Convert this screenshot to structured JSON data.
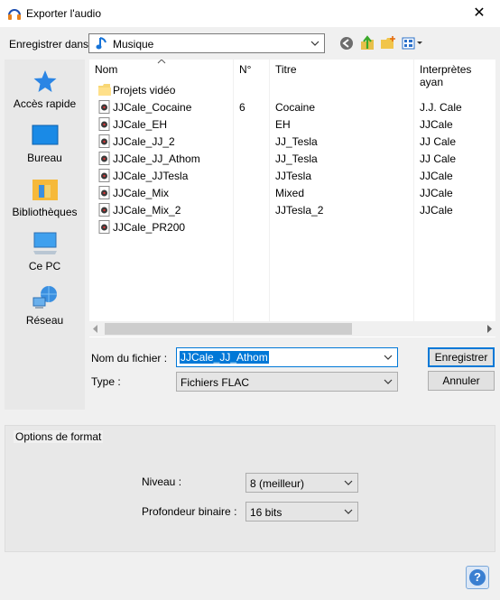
{
  "window": {
    "title": "Exporter l'audio",
    "close_glyph": "✕"
  },
  "save_in": {
    "label": "Enregistrer dans :",
    "value": "Musique"
  },
  "toolbar": {
    "icons": [
      "back-icon",
      "up-folder-icon",
      "new-folder-icon",
      "view-menu-icon"
    ]
  },
  "places": [
    {
      "label": "Accès rapide",
      "icon": "quick-access-star-icon"
    },
    {
      "label": "Bureau",
      "icon": "desktop-icon"
    },
    {
      "label": "Bibliothèques",
      "icon": "libraries-icon"
    },
    {
      "label": "Ce PC",
      "icon": "this-pc-icon"
    },
    {
      "label": "Réseau",
      "icon": "network-icon"
    }
  ],
  "file_list": {
    "columns": [
      "Nom",
      "N°",
      "Titre",
      "Interprètes ayan"
    ],
    "rows": [
      {
        "name": "Projets vidéo",
        "num": "",
        "title": "",
        "artist": "",
        "type": "folder"
      },
      {
        "name": "JJCale_Cocaine",
        "num": "6",
        "title": "Cocaine",
        "artist": "J.J. Cale",
        "type": "audio"
      },
      {
        "name": "JJCale_EH",
        "num": "",
        "title": "EH",
        "artist": "JJCale",
        "type": "audio"
      },
      {
        "name": "JJCale_JJ_2",
        "num": "",
        "title": "JJ_Tesla",
        "artist": "JJ Cale",
        "type": "audio"
      },
      {
        "name": "JJCale_JJ_Athom",
        "num": "",
        "title": "JJ_Tesla",
        "artist": "JJ Cale",
        "type": "audio"
      },
      {
        "name": "JJCale_JJTesla",
        "num": "",
        "title": "JJTesla",
        "artist": "JJCale",
        "type": "audio"
      },
      {
        "name": "JJCale_Mix",
        "num": "",
        "title": "Mixed",
        "artist": "JJCale",
        "type": "audio"
      },
      {
        "name": "JJCale_Mix_2",
        "num": "",
        "title": "JJTesla_2",
        "artist": "JJCale",
        "type": "audio"
      },
      {
        "name": "JJCale_PR200",
        "num": "",
        "title": "",
        "artist": "",
        "type": "audio"
      }
    ]
  },
  "filename": {
    "label": "Nom du fichier :",
    "value": "JJCale_JJ_Athom"
  },
  "filetype": {
    "label": "Type :",
    "value": "Fichiers FLAC"
  },
  "buttons": {
    "save": "Enregistrer",
    "cancel": "Annuler"
  },
  "format_options": {
    "legend": "Options de format",
    "level_label": "Niveau :",
    "level_value": "8 (meilleur)",
    "bitdepth_label": "Profondeur binaire :",
    "bitdepth_value": "16 bits"
  },
  "help": {
    "glyph": "?"
  },
  "colors": {
    "accent": "#0078d7",
    "folder": "#ffd35c",
    "window_bg": "#f0f0f0"
  }
}
